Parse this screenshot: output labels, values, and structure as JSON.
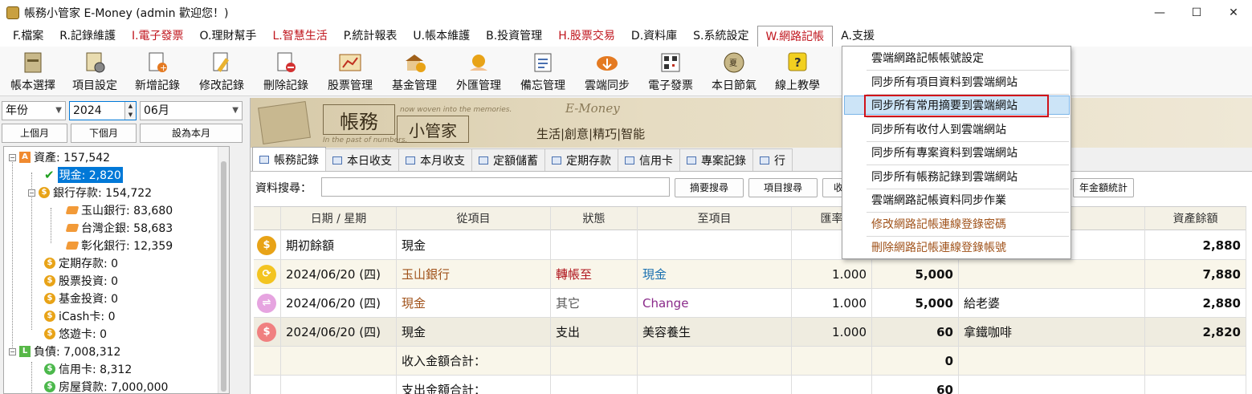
{
  "window": {
    "title": "帳務小管家 E-Money (admin 歡迎您！)",
    "controls": [
      "—",
      "☐",
      "✕"
    ]
  },
  "menu": [
    {
      "label": "F.檔案",
      "color": "normal"
    },
    {
      "label": "R.記錄維護",
      "color": "normal"
    },
    {
      "label": "I.電子發票",
      "color": "red"
    },
    {
      "label": "O.理財幫手",
      "color": "normal"
    },
    {
      "label": "L.智慧生活",
      "color": "red"
    },
    {
      "label": "P.統計報表",
      "color": "normal"
    },
    {
      "label": "U.帳本維護",
      "color": "normal"
    },
    {
      "label": "B.投資管理",
      "color": "normal"
    },
    {
      "label": "H.股票交易",
      "color": "red"
    },
    {
      "label": "D.資料庫",
      "color": "normal"
    },
    {
      "label": "S.系統設定",
      "color": "normal"
    },
    {
      "label": "W.網路記帳",
      "color": "active"
    },
    {
      "label": "A.支援",
      "color": "normal"
    }
  ],
  "toolbar": [
    {
      "label": "帳本選擇",
      "icon": "ledger-icon"
    },
    {
      "label": "項目設定",
      "icon": "item-settings-icon"
    },
    {
      "label": "新增記錄",
      "icon": "add-record-icon"
    },
    {
      "label": "修改記錄",
      "icon": "edit-record-icon"
    },
    {
      "label": "刪除記錄",
      "icon": "delete-record-icon"
    },
    {
      "label": "股票管理",
      "icon": "stock-icon"
    },
    {
      "label": "基金管理",
      "icon": "fund-icon"
    },
    {
      "label": "外匯管理",
      "icon": "forex-icon"
    },
    {
      "label": "備忘管理",
      "icon": "memo-icon"
    },
    {
      "label": "雲端同步",
      "icon": "cloud-sync-icon"
    },
    {
      "label": "電子發票",
      "icon": "qr-invoice-icon"
    },
    {
      "label": "本日節氣",
      "icon": "solar-term-icon"
    },
    {
      "label": "線上教學",
      "icon": "help-icon"
    }
  ],
  "filters": {
    "period_type": "年份",
    "year": "2024",
    "month": "06月",
    "prev_month": "上個月",
    "next_month": "下個月",
    "set_current": "設為本月"
  },
  "tree": {
    "assets": "資產: 157,542",
    "cash": "現金: 2,820",
    "bank": "銀行存款: 154,722",
    "bank1": "玉山銀行: 83,680",
    "bank2": "台灣企銀: 58,683",
    "bank3": "彰化銀行: 12,359",
    "fixed": "定期存款: 0",
    "stock": "股票投資: 0",
    "fund": "基金投資: 0",
    "icash": "iCash卡: 0",
    "easycard": "悠遊卡: 0",
    "liabilities": "負債: 7,008,312",
    "credit": "信用卡: 8,312",
    "mortgage": "房屋貸款: 7,000,000",
    "badge_assets": "A",
    "badge_liab": "L",
    "coin": "$"
  },
  "banner": {
    "title1": "帳務",
    "title2": "小管家",
    "tagline": "now woven into the memories.",
    "tagline2": "In the past of numbers.",
    "emoney": "E-Money",
    "slogan": "生活|創意|精巧|智能"
  },
  "tabs": [
    "帳務記錄",
    "本日收支",
    "本月收支",
    "定額儲蓄",
    "定期存款",
    "信用卡",
    "專案記錄",
    "行"
  ],
  "search": {
    "label": "資料搜尋：",
    "value": "",
    "btn_summary": "摘要搜尋",
    "btn_item": "項目搜尋",
    "btn_partial": "收",
    "btn_year_total": "年金額統計"
  },
  "grid": {
    "headers": [
      "日期 / 星期",
      "從項目",
      "狀態",
      "至項目",
      "匯率",
      "",
      "",
      "資產餘額"
    ],
    "rows": [
      {
        "icon": "money-bag-icon",
        "color": "#e8a317",
        "glyph": "$",
        "date": "期初餘額",
        "from": "現金",
        "status": "",
        "to": "",
        "rate": "",
        "amount": "",
        "memo": "",
        "balance": "2,880",
        "from_color": "#111",
        "status_color": "#111",
        "to_color": "#111",
        "bg": "#ffffff"
      },
      {
        "icon": "transfer-icon",
        "color": "#f3c420",
        "glyph": "⟳",
        "date": "2024/06/20 (四)",
        "from": "玉山銀行",
        "status": "轉帳至",
        "to": "現金",
        "rate": "1.000",
        "amount": "5,000",
        "memo": "",
        "balance": "7,880",
        "from_color": "#a0521a",
        "status_color": "#b0161e",
        "to_color": "#1a70b0",
        "bg": "#f9f6ea"
      },
      {
        "icon": "exchange-icon",
        "color": "#e6a4e0",
        "glyph": "⇌",
        "date": "2024/06/20 (四)",
        "from": "現金",
        "status": "其它",
        "to": "Change",
        "rate": "1.000",
        "amount": "5,000",
        "memo": "給老婆",
        "balance": "2,880",
        "from_color": "#a0521a",
        "status_color": "#555",
        "to_color": "#8a2a8a",
        "bg": "#ffffff"
      },
      {
        "icon": "expense-icon",
        "color": "#f08080",
        "glyph": "$",
        "date": "2024/06/20 (四)",
        "from": "現金",
        "status": "支出",
        "to": "美容養生",
        "rate": "1.000",
        "amount": "60",
        "memo": "拿鐵咖啡",
        "balance": "2,820",
        "from_color": "#111",
        "status_color": "#111",
        "to_color": "#111",
        "bg": "#efece0"
      },
      {
        "icon": "",
        "color": "",
        "glyph": "",
        "date": "",
        "from": "收入金額合計：",
        "status": "",
        "to": "",
        "rate": "",
        "amount": "0",
        "memo": "",
        "balance": "",
        "from_color": "#111",
        "status_color": "#111",
        "to_color": "#111",
        "bg": "#f9f6ea"
      },
      {
        "icon": "",
        "color": "",
        "glyph": "",
        "date": "",
        "from": "支出金額合計：",
        "status": "",
        "to": "",
        "rate": "",
        "amount": "60",
        "memo": "",
        "balance": "",
        "from_color": "#111",
        "status_color": "#111",
        "to_color": "#111",
        "bg": "#ffffff"
      }
    ]
  },
  "dropdown": {
    "items": [
      {
        "label": "雲端網路記帳帳號設定",
        "style": "normal"
      },
      {
        "label": "同步所有項目資料到雲端網站",
        "style": "normal"
      },
      {
        "label": "同步所有常用摘要到雲端網站",
        "style": "highlight"
      },
      {
        "label": "同步所有收付人到雲端網站",
        "style": "normal"
      },
      {
        "label": "同步所有專案資料到雲端網站",
        "style": "normal"
      },
      {
        "label": "同步所有帳務記錄到雲端網站",
        "style": "normal"
      },
      {
        "label": "雲端網路記帳資料同步作業",
        "style": "normal"
      },
      {
        "label": "修改網路記帳連線登錄密碼",
        "style": "brown"
      },
      {
        "label": "刪除網路記帳連線登錄帳號",
        "style": "brown"
      }
    ]
  }
}
